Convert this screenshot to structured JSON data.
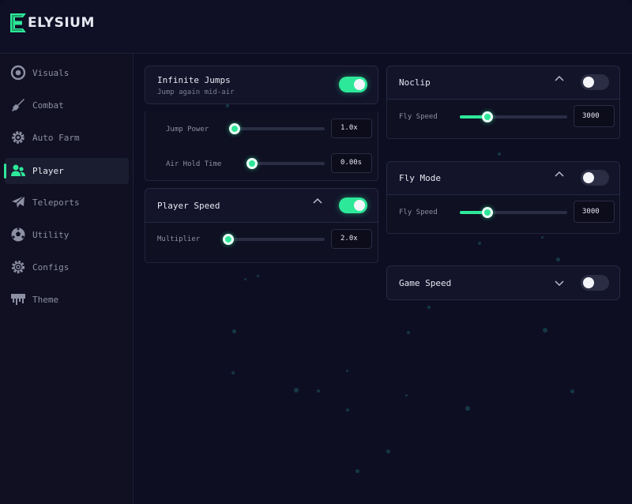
{
  "app": {
    "name": "ELYSIUM",
    "accent": "#2ee89a"
  },
  "sidebar": {
    "items": [
      {
        "label": "Visuals",
        "icon": "eye-icon",
        "active": false
      },
      {
        "label": "Combat",
        "icon": "sword-icon",
        "active": false
      },
      {
        "label": "Auto Farm",
        "icon": "gear-cog-icon",
        "active": false
      },
      {
        "label": "Player",
        "icon": "users-icon",
        "active": true
      },
      {
        "label": "Teleports",
        "icon": "paper-plane-icon",
        "active": false
      },
      {
        "label": "Utility",
        "icon": "ball-icon",
        "active": false
      },
      {
        "label": "Configs",
        "icon": "settings-icon",
        "active": false
      },
      {
        "label": "Theme",
        "icon": "paint-icon",
        "active": false
      }
    ]
  },
  "left": {
    "infinite_jumps": {
      "title": "Infinite Jumps",
      "subtitle": "Jump again mid-air",
      "enabled": true,
      "jump_power": {
        "label": "Jump Power",
        "value": "1.0x",
        "fraction": 0.0
      },
      "air_hold_time": {
        "label": "Air Hold Time",
        "value": "0.00s",
        "fraction": 0.0
      }
    },
    "player_speed": {
      "title": "Player Speed",
      "enabled": true,
      "multiplier": {
        "label": "Multiplier",
        "value": "2.0x",
        "fraction": 0.05
      }
    }
  },
  "right": {
    "noclip": {
      "title": "Noclip",
      "enabled": false,
      "fly_speed": {
        "label": "Fly Speed",
        "value": "3000",
        "fraction": 0.26
      }
    },
    "fly_mode": {
      "title": "Fly Mode",
      "enabled": false,
      "fly_speed": {
        "label": "Fly Speed",
        "value": "3000",
        "fraction": 0.26
      }
    },
    "game_speed": {
      "title": "Game Speed",
      "enabled": false
    }
  }
}
